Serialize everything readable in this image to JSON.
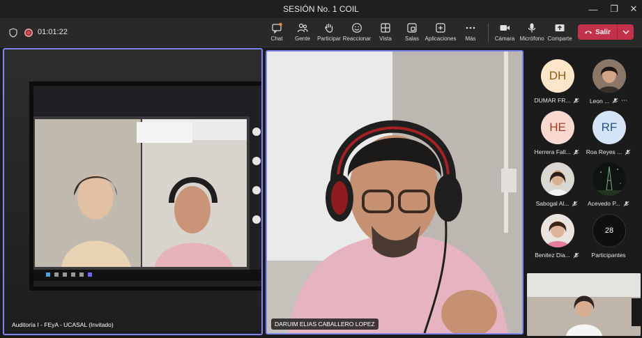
{
  "window": {
    "title": "SESIÓN No. 1 COIL",
    "min_glyph": "—",
    "max_glyph": "❐",
    "close_glyph": "✕"
  },
  "toolbar": {
    "timer": "01:01:22",
    "buttons": [
      {
        "label": "Chat",
        "icon": "chat-icon"
      },
      {
        "label": "Gente",
        "icon": "people-icon"
      },
      {
        "label": "Participar",
        "icon": "raise-hand-icon"
      },
      {
        "label": "Reaccionar",
        "icon": "smiley-icon"
      },
      {
        "label": "Vista",
        "icon": "grid-view-icon"
      },
      {
        "label": "Salas",
        "icon": "breakout-rooms-icon"
      },
      {
        "label": "Aplicaciones",
        "icon": "add-apps-icon"
      },
      {
        "label": "Más",
        "icon": "more-icon"
      },
      {
        "label": "Cámara",
        "icon": "camera-icon"
      },
      {
        "label": "Micrófono",
        "icon": "microphone-icon"
      },
      {
        "label": "Comparte",
        "icon": "share-icon"
      }
    ],
    "leave_label": "Salir"
  },
  "stage": {
    "tile1_name": "Auditoría I - FEyA - UCASAL (Invitado)",
    "tile2_name": "DARUIM ELIAS CABALLERO LOPEZ"
  },
  "participants": [
    {
      "name": "DUMAR FR...",
      "initials": "DH",
      "bg": "#fde7c8",
      "fg": "#8a5a1a"
    },
    {
      "name": "Leon ...",
      "initials": "",
      "photo": true
    },
    {
      "name": "Herrera Fall...",
      "initials": "HE",
      "bg": "#fbd9d0",
      "fg": "#a33a1e"
    },
    {
      "name": "Roa Reyes ...",
      "initials": "RF",
      "bg": "#d6e4f8",
      "fg": "#2b4f86"
    },
    {
      "name": "Sabogal Al...",
      "initials": "",
      "photo": true
    },
    {
      "name": "Acevedo P...",
      "initials": "",
      "photo": true
    },
    {
      "name": "Benitez Dia...",
      "initials": "",
      "photo": true
    },
    {
      "name": "Participantes",
      "initials": "28"
    }
  ],
  "colors": {
    "accent": "#7f85f5",
    "leave": "#c4314b",
    "record": "#e64650"
  }
}
